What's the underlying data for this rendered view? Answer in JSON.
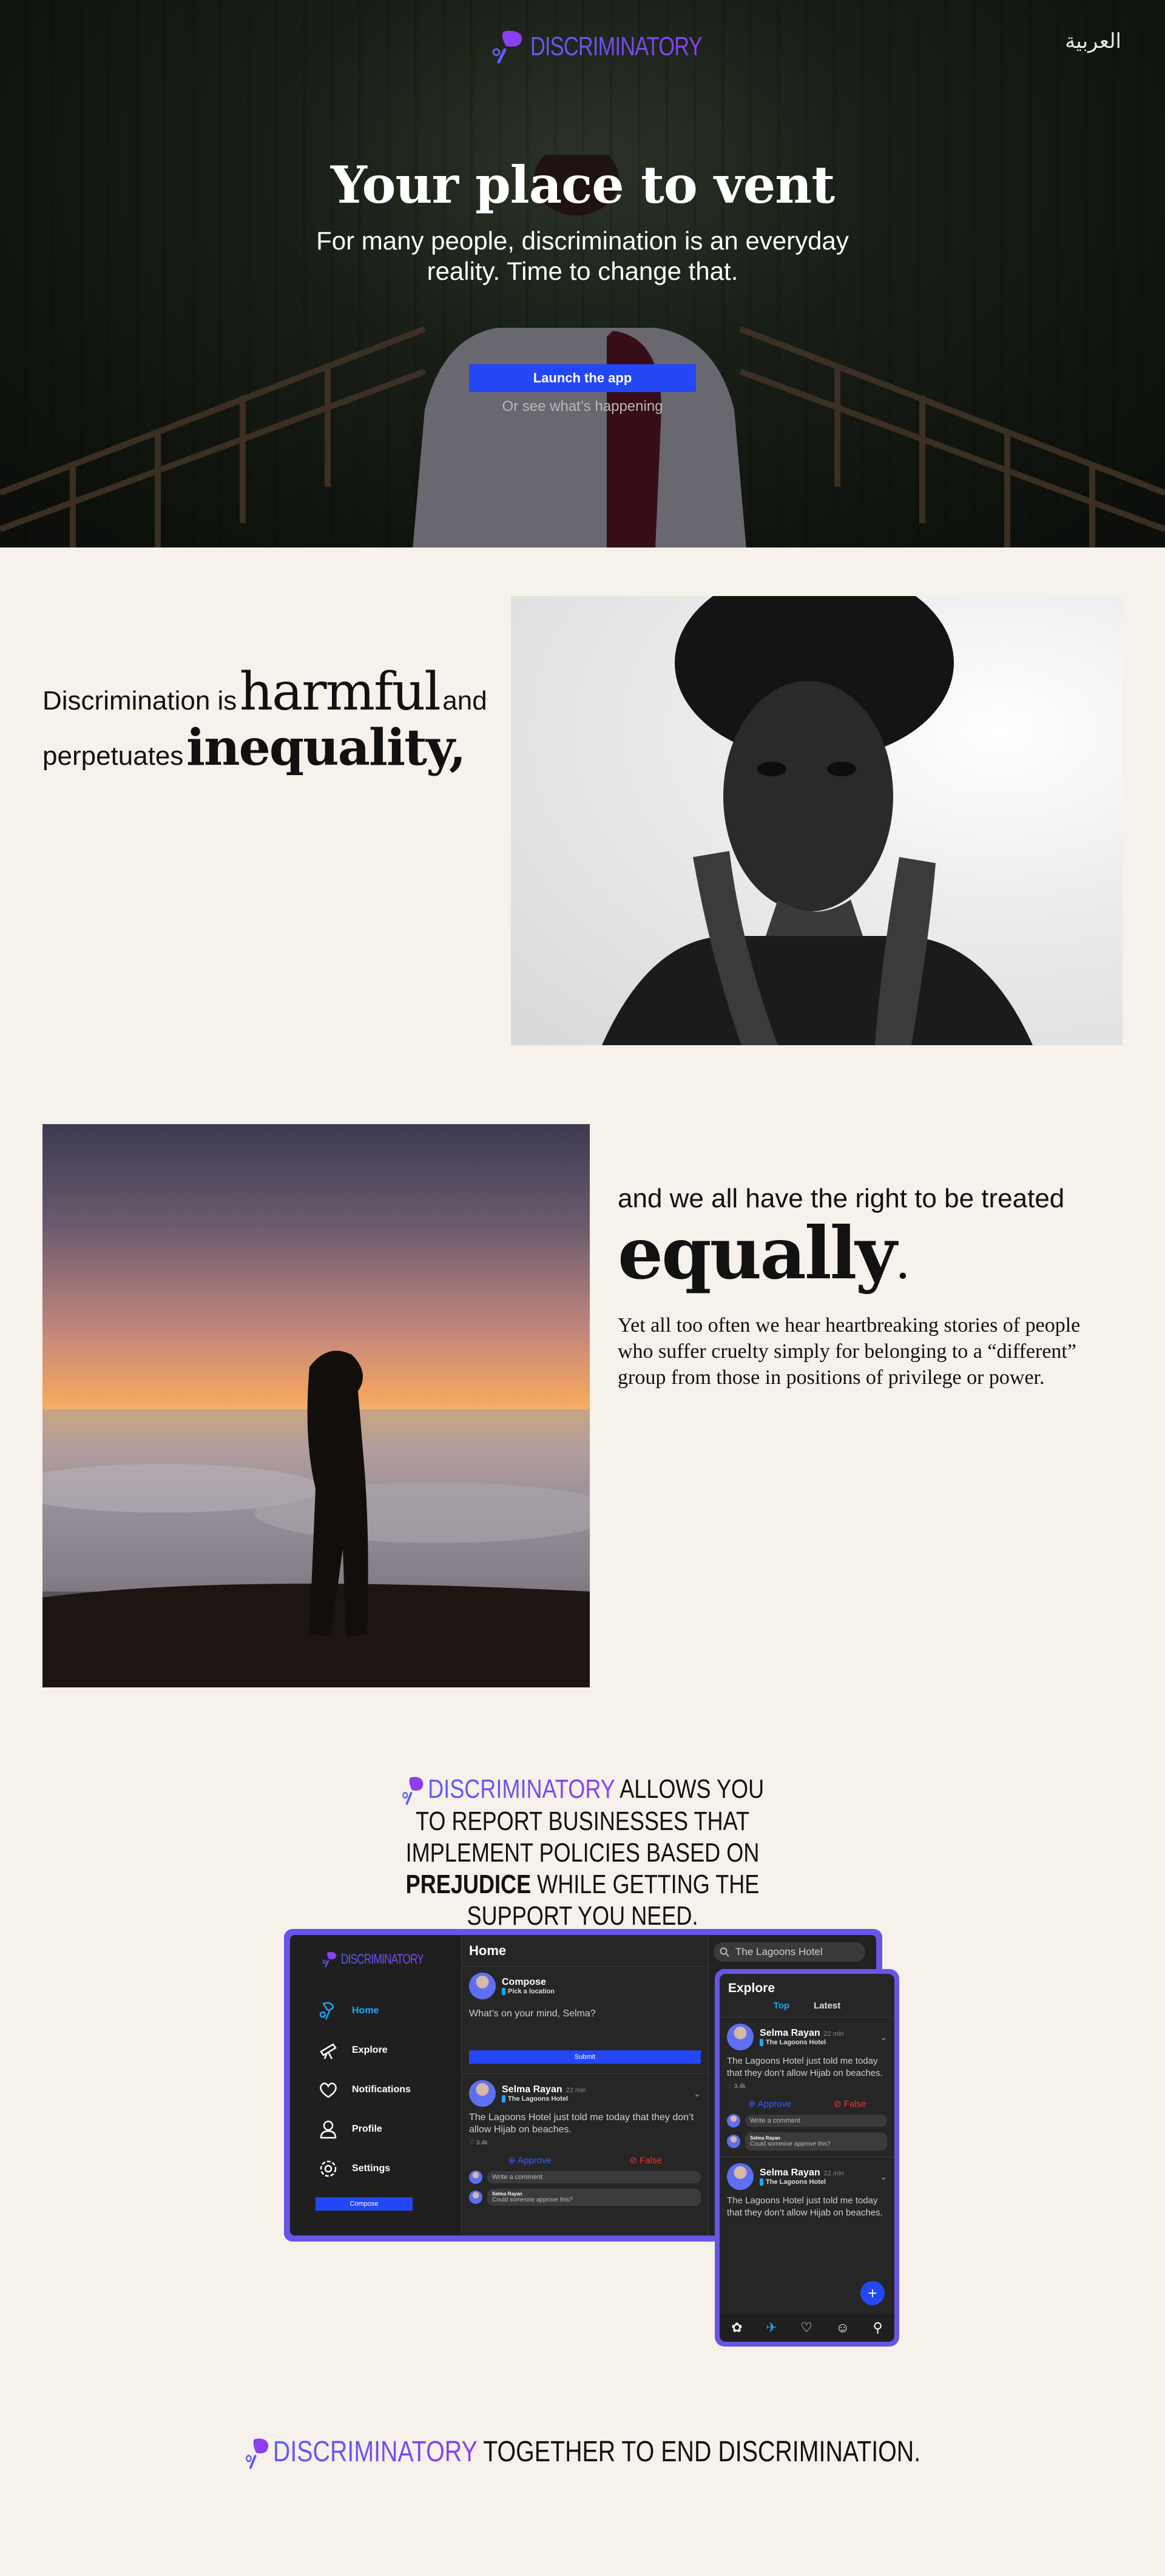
{
  "brand": {
    "name": "DISCRIMINATORY",
    "logo_icon": "leaf-logo-icon",
    "gradient": [
      "#5b5ff2",
      "#8a3ff0"
    ]
  },
  "hero": {
    "language_link": "العربية",
    "title": "Your place to vent",
    "subtitle": "For many people, discrimination is an everyday reality. Time to change that.",
    "cta": "Launch the app",
    "secondary": "Or see what’s happening",
    "accent": "#2447f5"
  },
  "harm": {
    "part1": "Discrimination is",
    "word1": "harmful",
    "part2": "and",
    "part3": "perpetuates",
    "word2": "inequality,"
  },
  "equal": {
    "lead": "and we all have the right to be treated",
    "word": "equally",
    "dot": ".",
    "body": "Yet all too often we hear heartbreaking stories of people who suffer cruelty simply for belonging to a “different” group from those in positions of privilege or power."
  },
  "report": {
    "brand": "DISCRIMINATORY",
    "text1": "ALLOWS YOU TO REPORT BUSINESSES THAT IMPLEMENT POLICIES BASED ON",
    "bold": "PREJUDICE",
    "text2": "WHILE GETTING THE SUPPORT YOU NEED."
  },
  "desktop_app": {
    "sidebar": {
      "brand": "DISCRIMINATORY",
      "items": [
        {
          "label": "Home",
          "icon": "home-icon"
        },
        {
          "label": "Explore",
          "icon": "explore-icon"
        },
        {
          "label": "Notifications",
          "icon": "heart-icon"
        },
        {
          "label": "Profile",
          "icon": "profile-icon"
        },
        {
          "label": "Settings",
          "icon": "gear-icon"
        }
      ],
      "compose": "Compose"
    },
    "main": {
      "title": "Home",
      "compose_name": "Compose",
      "compose_location": "Pick a location",
      "compose_placeholder": "What’s on your mind, Selma?",
      "submit": "Submit"
    },
    "post": {
      "author": "Selma Rayan",
      "time": "22 min",
      "location": "The Lagoons Hotel",
      "body": "The Lagoons Hotel just told me today that they don’t allow Hijab on beaches.",
      "likes": "3.4k",
      "approve": "Approve",
      "false": "False",
      "comment_placeholder": "Write a comment",
      "reply_author": "Selma Rayan",
      "reply_text": "Could someone approve this?"
    },
    "search_value": "The Lagoons Hotel"
  },
  "mobile_app": {
    "title": "Explore",
    "tabs": [
      "Top",
      "Latest"
    ],
    "post": {
      "author": "Selma Rayan",
      "time": "22 min",
      "location": "The Lagoons Hotel",
      "body": "The Lagoons Hotel just told me today that they don’t allow Hijab on beaches.",
      "likes": "3.4k",
      "approve": "Approve",
      "false": "False",
      "comment_placeholder": "Write a comment",
      "reply_author": "Selma Rayan",
      "reply_text": "Could someone approve this?"
    },
    "post2": {
      "author": "Selma Rayan",
      "time": "22 min",
      "location": "The Lagoons Hotel",
      "body": "The Lagoons Hotel just told me today that they don’t allow Hijab on beaches."
    }
  },
  "footer": {
    "brand": "DISCRIMINATORY",
    "tagline": "TOGETHER TO END DISCRIMINATION."
  }
}
